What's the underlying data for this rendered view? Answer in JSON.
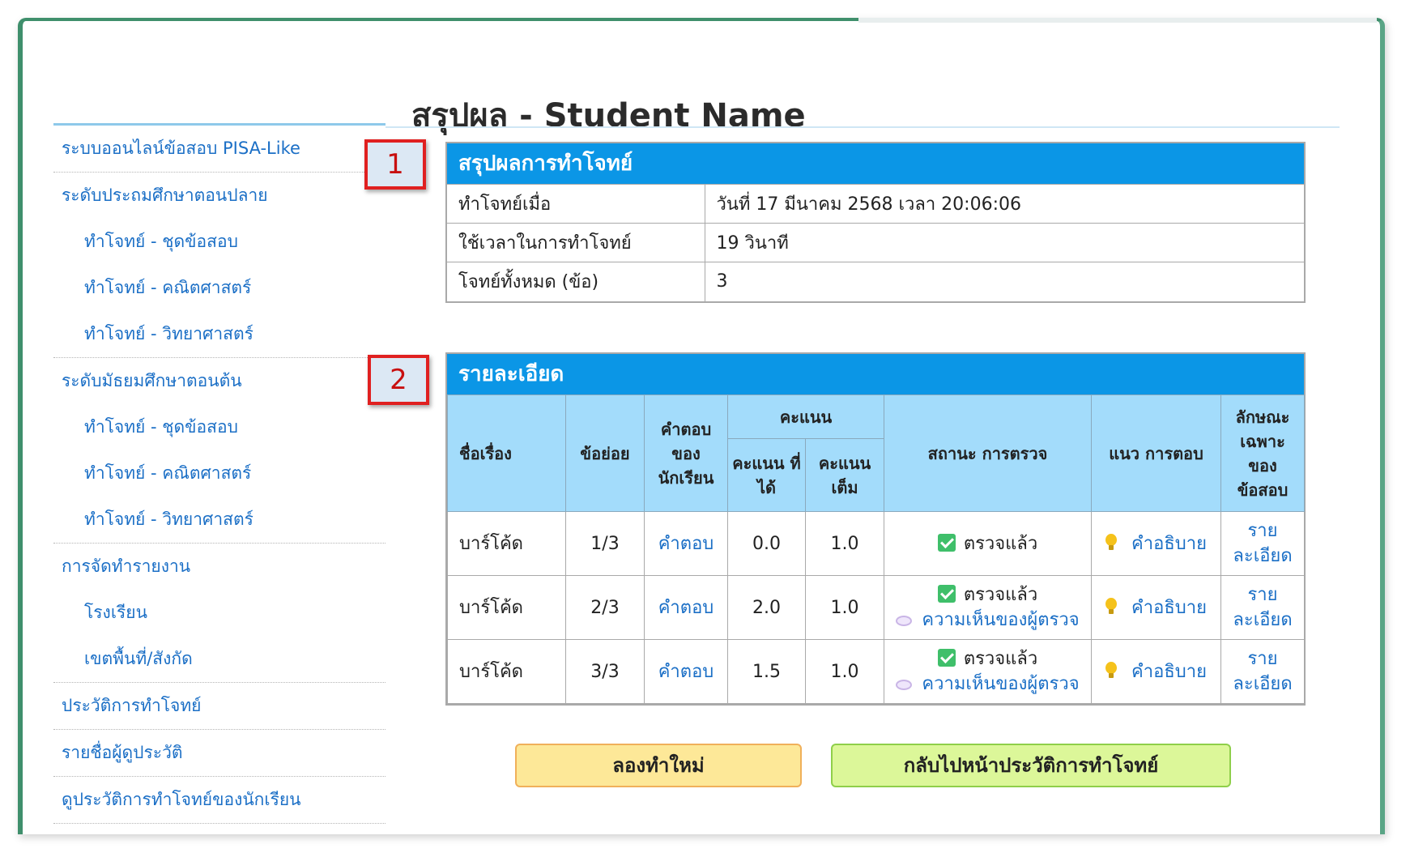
{
  "page": {
    "title": "สรุปผล - Student Name"
  },
  "markers": [
    "1",
    "2"
  ],
  "sidebar": {
    "sections": [
      {
        "items": [
          {
            "label": "ระบบออนไลน์ข้อสอบ PISA-Like",
            "sub": false
          }
        ]
      },
      {
        "items": [
          {
            "label": "ระดับประถมศึกษาตอนปลาย",
            "sub": false
          },
          {
            "label": "ทำโจทย์ - ชุดข้อสอบ",
            "sub": true
          },
          {
            "label": "ทำโจทย์ - คณิตศาสตร์",
            "sub": true
          },
          {
            "label": "ทำโจทย์ - วิทยาศาสตร์",
            "sub": true
          }
        ]
      },
      {
        "items": [
          {
            "label": "ระดับมัธยมศึกษาตอนต้น",
            "sub": false
          },
          {
            "label": "ทำโจทย์ - ชุดข้อสอบ",
            "sub": true
          },
          {
            "label": "ทำโจทย์ - คณิตศาสตร์",
            "sub": true
          },
          {
            "label": "ทำโจทย์ - วิทยาศาสตร์",
            "sub": true
          }
        ]
      },
      {
        "items": [
          {
            "label": "การจัดทำรายงาน",
            "sub": false
          },
          {
            "label": "โรงเรียน",
            "sub": true
          },
          {
            "label": "เขตพื้นที่/สังกัด",
            "sub": true
          }
        ]
      },
      {
        "items": [
          {
            "label": "ประวัติการทำโจทย์",
            "sub": false
          }
        ]
      },
      {
        "items": [
          {
            "label": "รายชื่อผู้ดูประวัติ",
            "sub": false
          }
        ]
      },
      {
        "items": [
          {
            "label": "ดูประวัติการทำโจทย์ของนักเรียน",
            "sub": false
          }
        ]
      }
    ]
  },
  "summary": {
    "heading": "สรุปผลการทำโจทย์",
    "rows": [
      {
        "label": "ทำโจทย์เมื่อ",
        "value": "วันที่ 17 มีนาคม 2568 เวลา 20:06:06"
      },
      {
        "label": "ใช้เวลาในการทำโจทย์",
        "value": "19 วินาที"
      },
      {
        "label": "โจทย์ทั้งหมด (ข้อ)",
        "value": "3"
      }
    ]
  },
  "detail": {
    "heading": "รายละเอียด",
    "headers": {
      "topic": "ชื่อเรื่อง",
      "sub_item": "ข้อย่อย",
      "answer": "คำตอบ ของ นักเรียน",
      "score": "คะแนน",
      "score_got": "คะแนน ที่ได้",
      "score_full": "คะแนน เต็ม",
      "status": "สถานะ การตรวจ",
      "approach": "แนว การตอบ",
      "feature": "ลักษณะ เฉพาะ ของ ข้อสอบ"
    },
    "rows": [
      {
        "topic": "บาร์โค้ด",
        "sub_item": "1/3",
        "answer": "คำตอบ",
        "got": "0.0",
        "full": "1.0",
        "status": "ตรวจแล้ว",
        "comment": "",
        "approach": "คำอธิบาย",
        "feature": "ราย ละเอียด"
      },
      {
        "topic": "บาร์โค้ด",
        "sub_item": "2/3",
        "answer": "คำตอบ",
        "got": "2.0",
        "full": "1.0",
        "status": "ตรวจแล้ว",
        "comment": "ความเห็นของผู้ตรวจ",
        "approach": "คำอธิบาย",
        "feature": "ราย ละเอียด"
      },
      {
        "topic": "บาร์โค้ด",
        "sub_item": "3/3",
        "answer": "คำตอบ",
        "got": "1.5",
        "full": "1.0",
        "status": "ตรวจแล้ว",
        "comment": "ความเห็นของผู้ตรวจ",
        "approach": "คำอธิบาย",
        "feature": "ราย ละเอียด"
      }
    ]
  },
  "buttons": {
    "retry": "ลองทำใหม่",
    "back": "กลับไปหน้าประวัติการทำโจทย์"
  },
  "colors": {
    "header_blue": "#0b96e6",
    "table_header": "#a3dcfb",
    "link": "#1b6fc6",
    "marker_red": "#e02020",
    "retry_bg": "#fde898",
    "back_bg": "#dcf799"
  },
  "icons": {
    "status": "check-icon",
    "comment": "speech-bubble-icon",
    "approach": "lightbulb-icon"
  }
}
